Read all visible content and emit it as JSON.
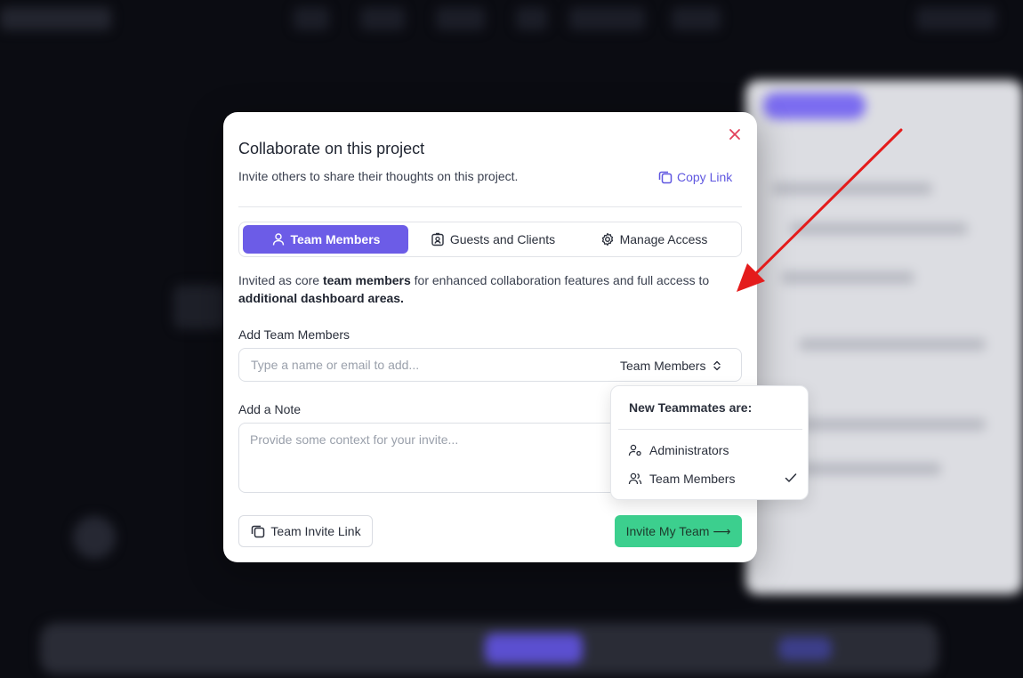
{
  "modal": {
    "title": "Collaborate on this project",
    "subtitle": "Invite others to share their thoughts on this project.",
    "copy_link": "Copy Link",
    "close_icon": "close-icon"
  },
  "tabs": [
    {
      "label": "Team Members",
      "icon": "user-icon",
      "active": true
    },
    {
      "label": "Guests and Clients",
      "icon": "id-badge-icon",
      "active": false
    },
    {
      "label": "Manage Access",
      "icon": "gear-icon",
      "active": false
    }
  ],
  "description": {
    "part1": "Invited as core ",
    "bold1": "team members",
    "part2": " for enhanced collaboration features and full access to ",
    "bold2": "additional dashboard areas."
  },
  "add_members": {
    "label": "Add Team Members",
    "placeholder": "Type a name or email to add...",
    "role_selected": "Team Members"
  },
  "note": {
    "label": "Add a Note",
    "placeholder": "Provide some context for your invite..."
  },
  "footer": {
    "team_invite_link": "Team Invite Link",
    "invite_button": "Invite My Team ⟶"
  },
  "dropdown": {
    "title": "New Teammates are:",
    "options": [
      {
        "label": "Administrators",
        "icon": "user-gear-icon",
        "selected": false
      },
      {
        "label": "Team Members",
        "icon": "users-icon",
        "selected": true
      }
    ]
  },
  "colors": {
    "accent": "#6c5ce7",
    "link": "#5f57e0",
    "invite_button": "#3ccf8e",
    "close": "#e2415b",
    "annotation_arrow": "#e41c1c"
  }
}
